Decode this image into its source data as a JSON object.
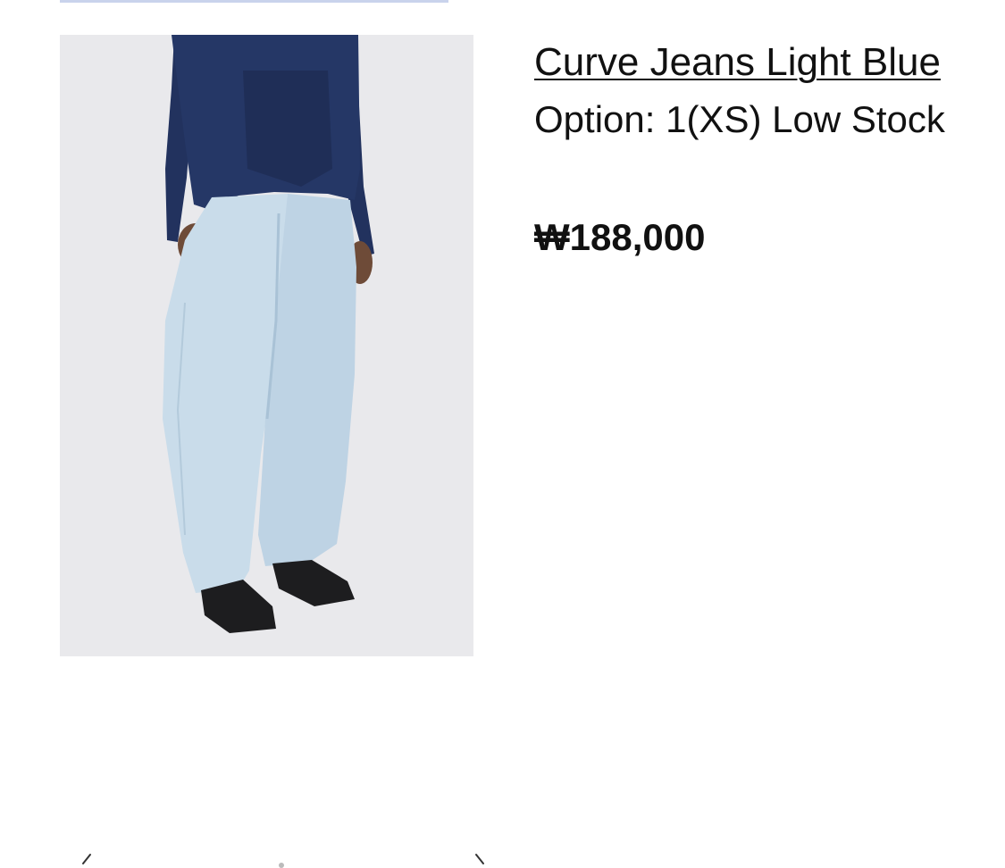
{
  "product": {
    "title": "Curve Jeans Light Blue",
    "option": "Option: 1(XS) Low Stock",
    "price": "₩188,000"
  },
  "image": {
    "description_icon": "product-photo",
    "background_color": "#e9e9ec",
    "sweater_color": "#22325e",
    "jeans_color": "#c9dcea",
    "shoe_color": "#1d1d1f"
  },
  "nav": {
    "prev_icon": "chevron-left-icon",
    "next_icon": "chevron-right-icon"
  }
}
